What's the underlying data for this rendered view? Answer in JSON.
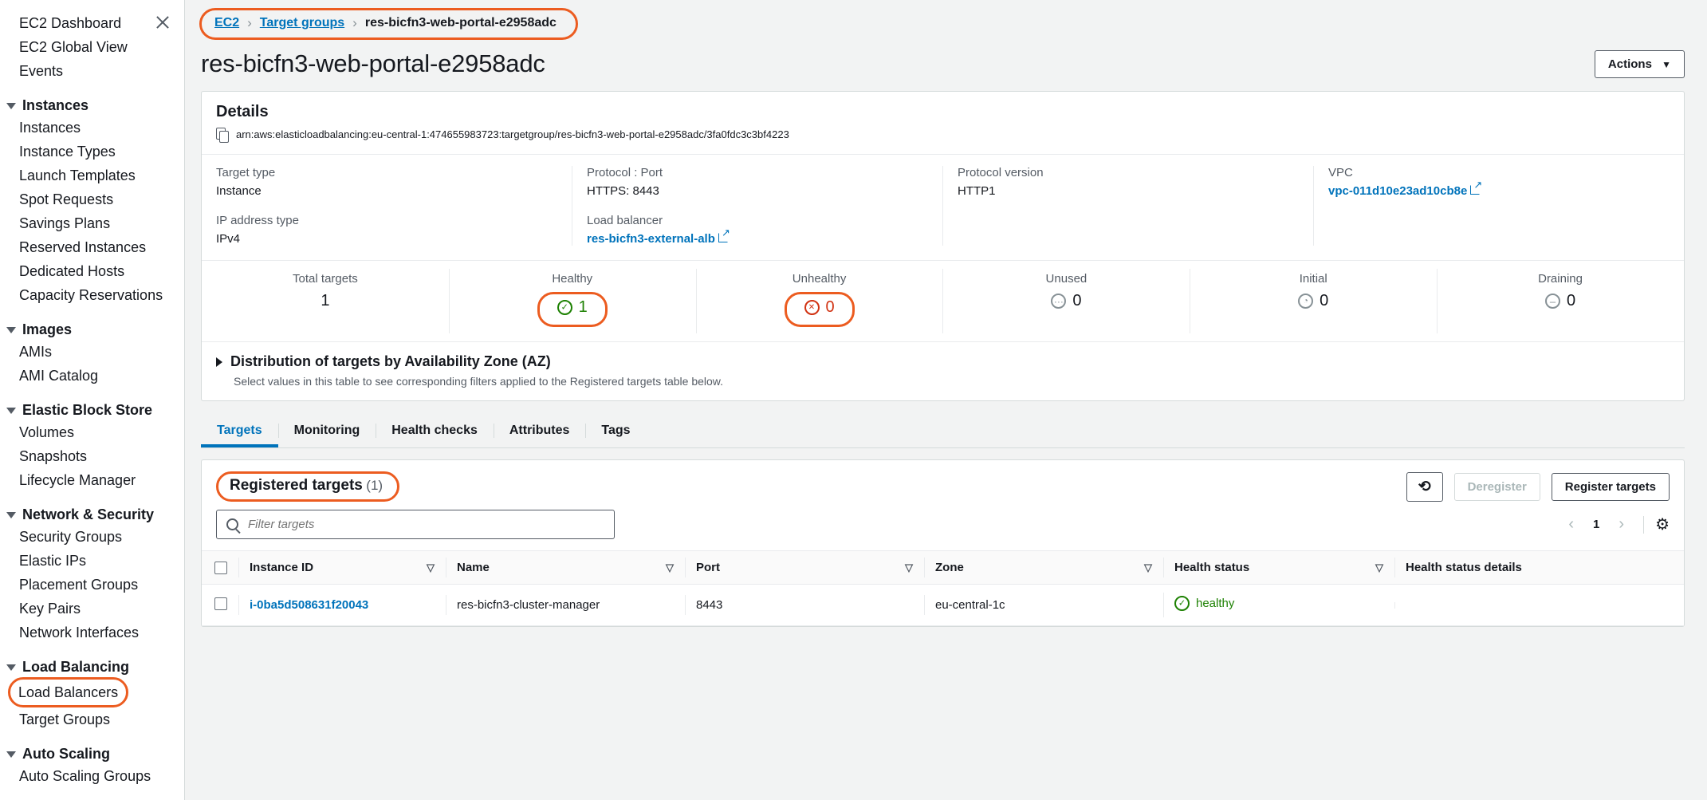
{
  "sidebar": {
    "top_links": [
      {
        "label": "EC2 Dashboard"
      },
      {
        "label": "EC2 Global View"
      },
      {
        "label": "Events"
      }
    ],
    "close_icon": "close-icon",
    "groups": [
      {
        "label": "Instances",
        "items": [
          {
            "label": "Instances"
          },
          {
            "label": "Instance Types"
          },
          {
            "label": "Launch Templates"
          },
          {
            "label": "Spot Requests"
          },
          {
            "label": "Savings Plans"
          },
          {
            "label": "Reserved Instances"
          },
          {
            "label": "Dedicated Hosts"
          },
          {
            "label": "Capacity Reservations"
          }
        ]
      },
      {
        "label": "Images",
        "items": [
          {
            "label": "AMIs"
          },
          {
            "label": "AMI Catalog"
          }
        ]
      },
      {
        "label": "Elastic Block Store",
        "items": [
          {
            "label": "Volumes"
          },
          {
            "label": "Snapshots"
          },
          {
            "label": "Lifecycle Manager"
          }
        ]
      },
      {
        "label": "Network & Security",
        "items": [
          {
            "label": "Security Groups"
          },
          {
            "label": "Elastic IPs"
          },
          {
            "label": "Placement Groups"
          },
          {
            "label": "Key Pairs"
          },
          {
            "label": "Network Interfaces"
          }
        ]
      },
      {
        "label": "Load Balancing",
        "items": [
          {
            "label": "Load Balancers",
            "highlighted": true
          },
          {
            "label": "Target Groups"
          }
        ]
      },
      {
        "label": "Auto Scaling",
        "items": [
          {
            "label": "Auto Scaling Groups"
          }
        ]
      }
    ]
  },
  "breadcrumb": {
    "items": [
      "EC2",
      "Target groups",
      "res-bicfn3-web-portal-e2958adc"
    ],
    "separator": "›"
  },
  "header": {
    "title": "res-bicfn3-web-portal-e2958adc",
    "actions_label": "Actions",
    "actions_caret": "▼"
  },
  "details": {
    "section_title": "Details",
    "arn": "arn:aws:elasticloadbalancing:eu-central-1:474655983723:targetgroup/res-bicfn3-web-portal-e2958adc/3fa0fdc3c3bf4223",
    "copy_icon": "copy-icon",
    "fields": [
      {
        "label": "Target type",
        "value": "Instance",
        "link": false
      },
      {
        "label": "IP address type",
        "value": "IPv4",
        "link": false
      },
      {
        "label": "Protocol : Port",
        "value": "HTTPS: 8443",
        "link": false
      },
      {
        "label": "Load balancer",
        "value": "res-bicfn3-external-alb",
        "link": true
      },
      {
        "label": "Protocol version",
        "value": "HTTP1",
        "link": false
      },
      {
        "label": "VPC",
        "value": "vpc-011d10e23ad10cb8e",
        "link": true
      }
    ]
  },
  "counters": [
    {
      "label": "Total targets",
      "value": "1",
      "icon": "none",
      "color": "black",
      "highlighted": false
    },
    {
      "label": "Healthy",
      "value": "1",
      "icon": "check-circle-icon",
      "color": "green",
      "highlighted": true
    },
    {
      "label": "Unhealthy",
      "value": "0",
      "icon": "x-circle-icon",
      "color": "red",
      "highlighted": true
    },
    {
      "label": "Unused",
      "value": "0",
      "icon": "dots-circle-icon",
      "color": "black",
      "highlighted": false
    },
    {
      "label": "Initial",
      "value": "0",
      "icon": "clock-circle-icon",
      "color": "black",
      "highlighted": false
    },
    {
      "label": "Draining",
      "value": "0",
      "icon": "minus-circle-icon",
      "color": "black",
      "highlighted": false
    }
  ],
  "distribution": {
    "title": "Distribution of targets by Availability Zone (AZ)",
    "subtitle": "Select values in this table to see corresponding filters applied to the Registered targets table below.",
    "expand_icon": "triangle-right-icon"
  },
  "tabs": [
    {
      "label": "Targets",
      "active": true
    },
    {
      "label": "Monitoring",
      "active": false
    },
    {
      "label": "Health checks",
      "active": false
    },
    {
      "label": "Attributes",
      "active": false
    },
    {
      "label": "Tags",
      "active": false
    }
  ],
  "registered": {
    "title": "Registered targets",
    "count": "(1)",
    "refresh_icon": "refresh-icon",
    "deregister_label": "Deregister",
    "register_label": "Register targets",
    "filter_placeholder": "Filter targets",
    "filter_value": "",
    "search_icon": "search-icon",
    "page_prev": "‹",
    "page_number": "1",
    "page_next": "›",
    "settings_icon": "gear-icon",
    "columns": [
      "Instance ID",
      "Name",
      "Port",
      "Zone",
      "Health status",
      "Health status details"
    ],
    "sort_icon": "▽",
    "rows": [
      {
        "instance_id": "i-0ba5d508631f20043",
        "name": "res-bicfn3-cluster-manager",
        "port": "8443",
        "zone": "eu-central-1c",
        "health_status": "healthy",
        "health_status_details": ""
      }
    ]
  },
  "colors": {
    "accent": "#0073bb",
    "annotation": "#ec5c20",
    "healthy": "#1d8102",
    "unhealthy": "#d13212"
  }
}
